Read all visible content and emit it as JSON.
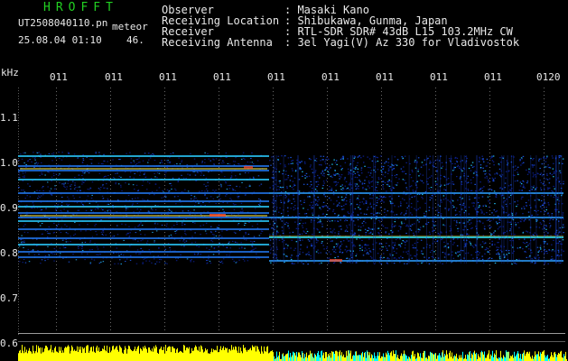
{
  "header": {
    "app_title": "HROFFT",
    "file_name": "UT2508040110.pn",
    "mode": "meteor",
    "date_time": "25.08.04 01:10",
    "index": "46."
  },
  "info": [
    {
      "label": "Observer",
      "value": ": Masaki Kano"
    },
    {
      "label": "Receiving Location",
      "value": ": Shibukawa, Gunma, Japan"
    },
    {
      "label": "Receiver",
      "value": ": RTL-SDR SDR# 43dB L15 103.2MHz CW"
    },
    {
      "label": "Receiving Antenna",
      "value": ": 3el Yagi(V) Az 330 for Vladivostok"
    }
  ],
  "axis": {
    "unit": "kHz",
    "time_ticks": [
      "011",
      "011",
      "011",
      "011",
      "011",
      "011",
      "011",
      "011",
      "011",
      "0120"
    ],
    "freq_ticks": [
      "1.1",
      "1.0",
      "0.9",
      "0.8",
      "0.7",
      "0.6"
    ]
  },
  "colors": {
    "background": "#000000",
    "title": "#22d022",
    "text": "#e8e8e8",
    "signal_level": "#ffff00",
    "signal_level_alt": "#00ffff"
  }
}
